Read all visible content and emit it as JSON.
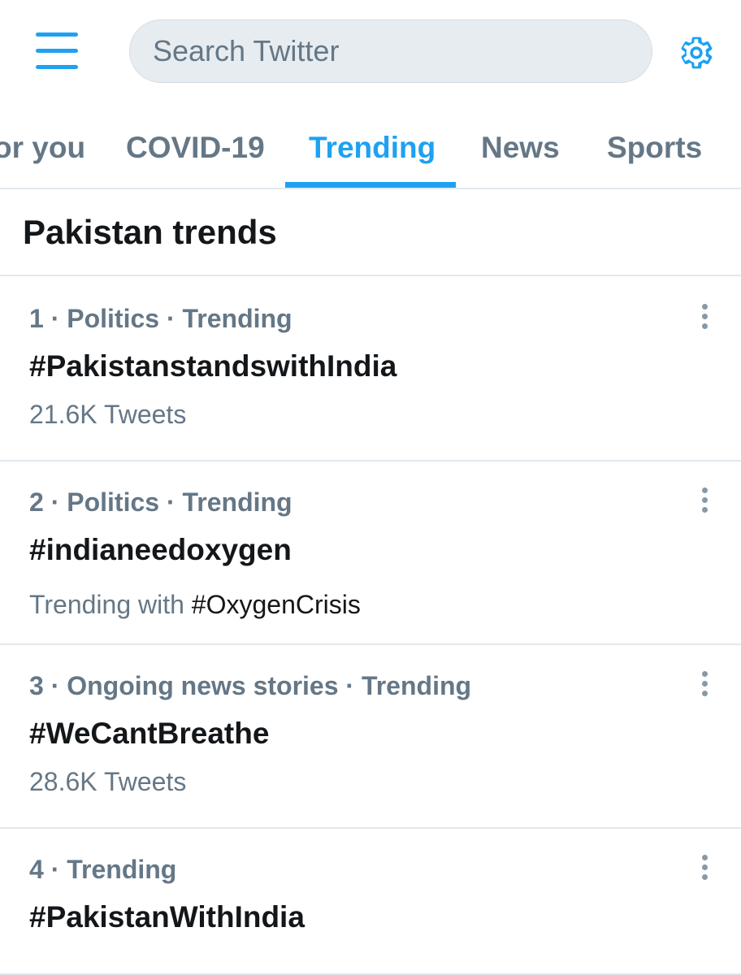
{
  "header": {
    "menu_icon": "hamburger-menu-icon",
    "search_placeholder": "Search Twitter",
    "settings_icon": "gear-icon"
  },
  "tabs": [
    {
      "label": "For you",
      "visible_label": "or you",
      "active": false
    },
    {
      "label": "COVID-19",
      "active": false
    },
    {
      "label": "Trending",
      "active": true
    },
    {
      "label": "News",
      "active": false
    },
    {
      "label": "Sports",
      "active": false
    }
  ],
  "section": {
    "title": "Pakistan trends"
  },
  "trends": [
    {
      "meta": "1 · Politics · Trending",
      "name": "#PakistanstandswithIndia",
      "sub": "21.6K Tweets"
    },
    {
      "meta": "2 · Politics · Trending",
      "name": "#indianeedoxygen",
      "sub_prefix": "Trending with ",
      "sub_tag": "#OxygenCrisis"
    },
    {
      "meta": "3 · Ongoing news stories · Trending",
      "name": "#WeCantBreathe",
      "sub": "28.6K Tweets"
    },
    {
      "meta": "4 · Trending",
      "name": "#PakistanWithIndia"
    }
  ],
  "colors": {
    "accent": "#1da1f2",
    "secondary_text": "#657786",
    "primary_text": "#14171a",
    "divider": "#e1e8ed",
    "search_bg": "#e6ecf0"
  }
}
